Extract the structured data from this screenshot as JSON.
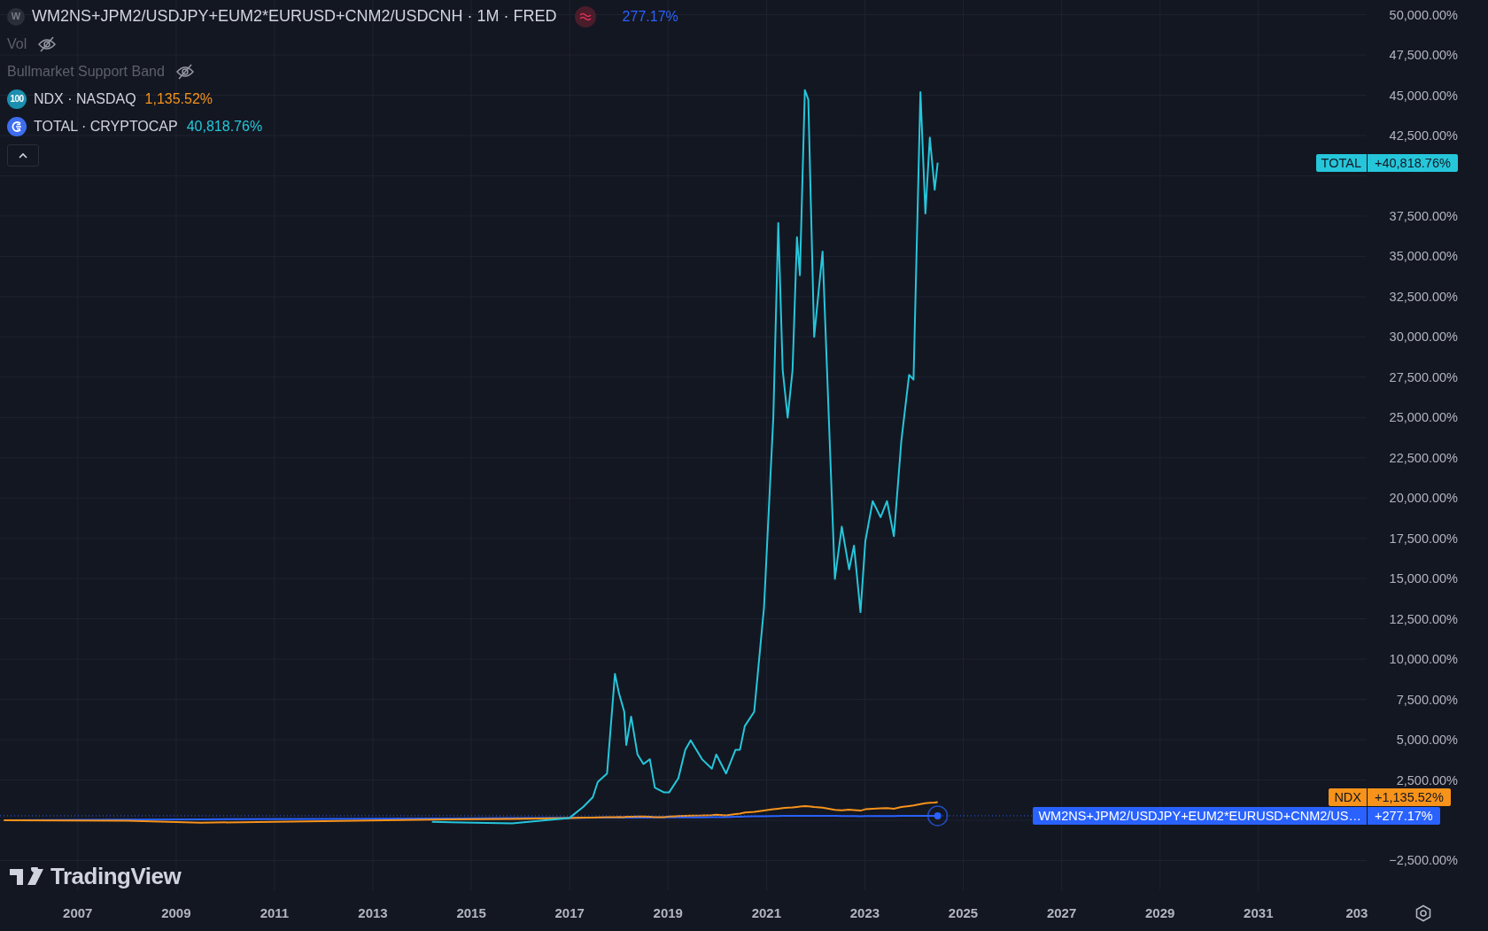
{
  "legend": {
    "main": {
      "badge": "W",
      "title": "WM2NS+JPM2/USDJPY+EUM2*EURUSD+CNM2/USDCNH · 1M · FRED",
      "value": "277.17%",
      "color": "#2962ff"
    },
    "indicators": [
      {
        "label": "Vol",
        "hidden": true
      },
      {
        "label": "Bullmarket Support Band",
        "hidden": true
      }
    ],
    "symbols": [
      {
        "badge": "100",
        "label": "NDX · NASDAQ",
        "value": "1,135.52%",
        "color": "#f7931a",
        "kind": "index"
      },
      {
        "label": "TOTAL · CRYPTOCAP",
        "value": "40,818.76%",
        "color": "#26c6da",
        "kind": "crypto"
      }
    ],
    "collapsed": false
  },
  "chart": {
    "chart_data": {
      "type": "line",
      "grid": true,
      "xlim": [
        2005.42,
        2033.2
      ],
      "ylim": [
        -4343,
        50912
      ],
      "ref_lines": [
        {
          "axis": "y",
          "value": 277.17,
          "color": "#2962ff"
        }
      ],
      "x": [
        2005.5,
        2008,
        2009.5,
        2012,
        2014.2,
        2015.83,
        2016.99,
        2017.28,
        2017.47,
        2017.57,
        2017.76,
        2017.92,
        2018.0,
        2018.11,
        2018.15,
        2018.25,
        2018.38,
        2018.5,
        2018.63,
        2018.73,
        2018.92,
        2019.02,
        2019.21,
        2019.35,
        2019.46,
        2019.69,
        2019.89,
        2019.98,
        2020.18,
        2020.37,
        2020.46,
        2020.56,
        2020.75,
        2020.95,
        2021.14,
        2021.24,
        2021.33,
        2021.43,
        2021.53,
        2021.62,
        2021.68,
        2021.78,
        2021.85,
        2021.97,
        2022.14,
        2022.39,
        2022.53,
        2022.68,
        2022.78,
        2022.91,
        2023.01,
        2023.16,
        2023.32,
        2023.45,
        2023.59,
        2023.74,
        2023.9,
        2023.99,
        2024.13,
        2024.23,
        2024.32,
        2024.42,
        2024.48
      ],
      "series": [
        {
          "name": "TOTAL",
          "color": "#26c6da",
          "values": [
            null,
            null,
            null,
            null,
            -100,
            -200,
            135,
            842,
            1431,
            2374,
            2904,
            9090,
            7911,
            6733,
            4671,
            6438,
            4082,
            3493,
            3788,
            2021,
            1726,
            1726,
            2610,
            4377,
            4966,
            3788,
            3199,
            4082,
            2904,
            4377,
            4377,
            5849,
            6733,
            13213,
            24995,
            37072,
            27941,
            24995,
            27941,
            36188,
            33832,
            45319,
            44730,
            30003,
            35305,
            14981,
            18221,
            15570,
            17043,
            12918,
            17337,
            19811,
            18810,
            19811,
            17632,
            23522,
            27646,
            27352,
            45201,
            37661,
            42374,
            39134,
            40818
          ]
        },
        {
          "name": "NDX",
          "color": "#f7931a",
          "values": [
            0,
            -30,
            -150,
            -60,
            40,
            90,
            140,
            160,
            170,
            180,
            190,
            200,
            210,
            200,
            215,
            220,
            230,
            235,
            225,
            200,
            190,
            230,
            260,
            280,
            290,
            300,
            320,
            340,
            300,
            380,
            420,
            480,
            520,
            600,
            680,
            720,
            760,
            780,
            800,
            830,
            850,
            880,
            870,
            820,
            780,
            650,
            620,
            660,
            640,
            600,
            680,
            720,
            740,
            760,
            720,
            820,
            880,
            920,
            1000,
            1060,
            1090,
            1100,
            1135
          ]
        },
        {
          "name": "WM2NS+JPM2/USDJPY+EUM2*EURUSD+CNM2/US…",
          "color": "#2962ff",
          "values": [
            0,
            40,
            60,
            90,
            110,
            130,
            150,
            155,
            158,
            160,
            162,
            165,
            166,
            167,
            168,
            170,
            171,
            172,
            173,
            174,
            175,
            176,
            178,
            180,
            182,
            184,
            186,
            190,
            200,
            215,
            225,
            235,
            245,
            255,
            262,
            265,
            268,
            270,
            272,
            275,
            278,
            280,
            282,
            280,
            278,
            270,
            265,
            260,
            258,
            255,
            258,
            262,
            265,
            266,
            266,
            268,
            270,
            271,
            272,
            274,
            275,
            276,
            277
          ]
        }
      ],
      "xticks": [
        2007,
        2009,
        2011,
        2013,
        2015,
        2017,
        2019,
        2021,
        2023,
        2025,
        2027,
        2029,
        2031
      ],
      "yticks": [
        {
          "value": -2500,
          "label": "−2,500.00%"
        },
        {
          "value": 2500,
          "label": "2,500.00%"
        },
        {
          "value": 5000,
          "label": "5,000.00%"
        },
        {
          "value": 7500,
          "label": "7,500.00%"
        },
        {
          "value": 10000,
          "label": "10,000.00%"
        },
        {
          "value": 12500,
          "label": "12,500.00%"
        },
        {
          "value": 15000,
          "label": "15,000.00%"
        },
        {
          "value": 17500,
          "label": "17,500.00%"
        },
        {
          "value": 20000,
          "label": "20,000.00%"
        },
        {
          "value": 22500,
          "label": "22,500.00%"
        },
        {
          "value": 25000,
          "label": "25,000.00%"
        },
        {
          "value": 27500,
          "label": "27,500.00%"
        },
        {
          "value": 30000,
          "label": "30,000.00%"
        },
        {
          "value": 32500,
          "label": "32,500.00%"
        },
        {
          "value": 35000,
          "label": "35,000.00%"
        },
        {
          "value": 37500,
          "label": "37,500.00%"
        },
        {
          "value": 42500,
          "label": "42,500.00%"
        },
        {
          "value": 45000,
          "label": "45,000.00%"
        },
        {
          "value": 47500,
          "label": "47,500.00%"
        },
        {
          "value": 50000,
          "label": "50,000.00%"
        }
      ]
    },
    "cut_off_axis_label": "203",
    "price_tags": [
      {
        "value": "+40,818.76%"
      },
      {
        "value": "+1,135.52%"
      },
      {
        "value": "+277.17%"
      }
    ]
  },
  "branding": "TradingView"
}
